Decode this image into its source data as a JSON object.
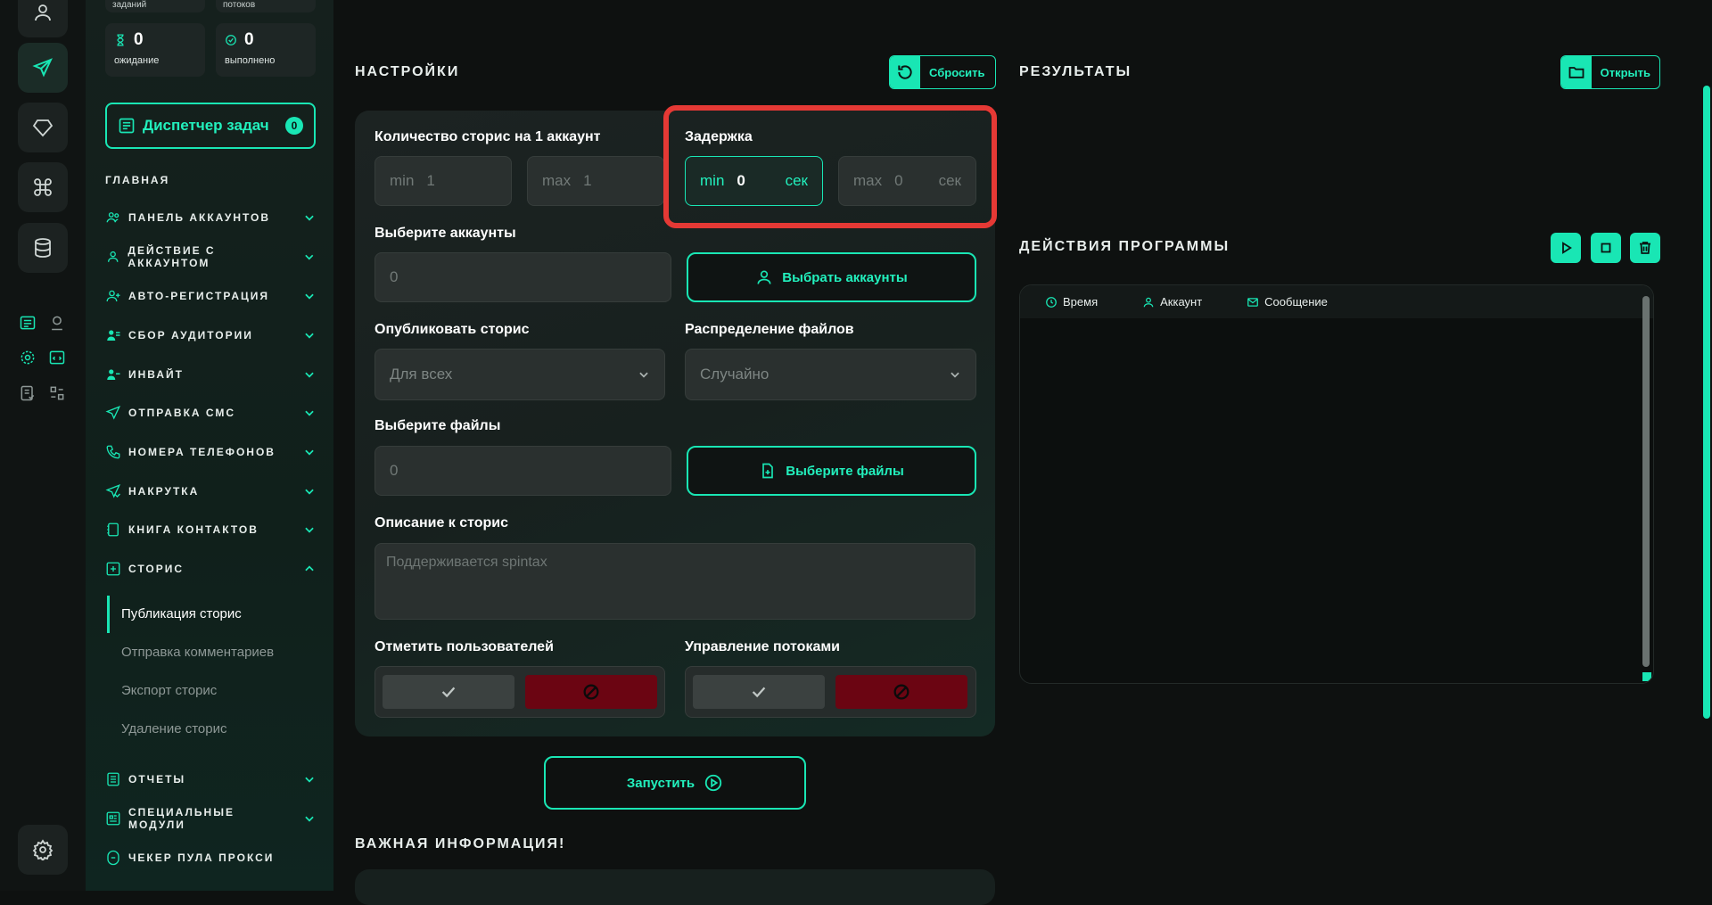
{
  "sidebar": {
    "stat_top_left": "заданий",
    "stat_top_right": "потоков",
    "stats": [
      {
        "value": "0",
        "label": "ожидание"
      },
      {
        "value": "0",
        "label": "выполнено"
      }
    ],
    "dispatcher": {
      "label": "Диспетчер задач",
      "count": "0"
    },
    "section_title": "ГЛАВНАЯ",
    "items": [
      {
        "label": "ПАНЕЛЬ АККАУНТОВ"
      },
      {
        "label": "ДЕЙСТВИЕ С АККАУНТОМ"
      },
      {
        "label": "АВТО-РЕГИСТРАЦИЯ"
      },
      {
        "label": "СБОР АУДИТОРИИ"
      },
      {
        "label": "ИНВАЙТ"
      },
      {
        "label": "ОТПРАВКА СМС"
      },
      {
        "label": "НОМЕРА ТЕЛЕФОНОВ"
      },
      {
        "label": "НАКРУТКА"
      },
      {
        "label": "КНИГА КОНТАКТОВ"
      },
      {
        "label": "СТОРИС"
      }
    ],
    "stories_sub": [
      {
        "label": "Публикация сторис"
      },
      {
        "label": "Отправка комментариев"
      },
      {
        "label": "Экспорт сторис"
      },
      {
        "label": "Удаление сторис"
      }
    ],
    "bottom_items": [
      {
        "label": "ОТЧЕТЫ"
      },
      {
        "label": "СПЕЦИАЛЬНЫЕ МОДУЛИ"
      },
      {
        "label": "ЧЕКЕР ПУЛА ПРОКСИ"
      }
    ]
  },
  "settings": {
    "title": "НАСТРОЙКИ",
    "reset_label": "Сбросить",
    "stories_count": {
      "label": "Количество сторис на 1 аккаунт",
      "min_prefix": "min",
      "min_value": "1",
      "max_prefix": "max",
      "max_value": "1"
    },
    "delay": {
      "label": "Задержка",
      "min_prefix": "min",
      "min_value": "0",
      "max_prefix": "max",
      "max_value": "0",
      "unit": "сек"
    },
    "accounts": {
      "label": "Выберите аккаунты",
      "value": "0",
      "button": "Выбрать аккаунты"
    },
    "publish": {
      "label": "Опубликовать сторис",
      "selected": "Для всех"
    },
    "distribution": {
      "label": "Распределение файлов",
      "selected": "Случайно"
    },
    "files": {
      "label": "Выберите файлы",
      "value": "0",
      "button": "Выберите файлы"
    },
    "description": {
      "label": "Описание к сторис",
      "placeholder": "Поддерживается spintax"
    },
    "mark_users": {
      "label": "Отметить пользователей"
    },
    "threads": {
      "label": "Управление потоками"
    },
    "run_label": "Запустить",
    "important_title": "ВАЖНАЯ ИНФОРМАЦИЯ!"
  },
  "results": {
    "title": "РЕЗУЛЬТАТЫ",
    "open_label": "Открыть"
  },
  "actions": {
    "title": "ДЕЙСТВИЯ ПРОГРАММЫ",
    "columns": [
      "Время",
      "Аккаунт",
      "Сообщение"
    ]
  },
  "colors": {
    "accent": "#19e6b4",
    "danger": "#6b0512",
    "highlight": "#e53935",
    "background": "#0e1110"
  }
}
